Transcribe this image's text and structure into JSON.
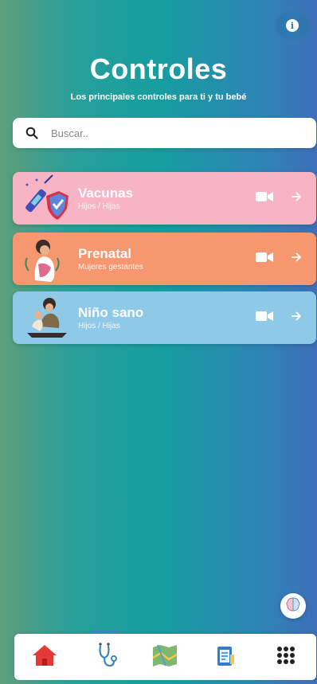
{
  "header": {
    "title": "Controles",
    "subtitle": "Los principales controles para ti y tu bebé"
  },
  "search": {
    "placeholder": "Buscar..",
    "value": ""
  },
  "cards": [
    {
      "name": "Vacunas",
      "subtitle": "Hijos / Hijas",
      "color": "#f7b4c4"
    },
    {
      "name": "Prenatal",
      "subtitle": "Mujeres gestantes",
      "color": "#f6976f"
    },
    {
      "name": "Niño sano",
      "subtitle": "Hijos / Hijas",
      "color": "#8ec9e8"
    }
  ],
  "icons": {
    "info": "info-icon",
    "search": "search-icon",
    "video": "video-camera-icon",
    "arrow": "arrow-right-icon",
    "fab": "brain-icon"
  },
  "bottom_nav": [
    {
      "icon": "home-icon",
      "active": false
    },
    {
      "icon": "stethoscope-icon",
      "active": true
    },
    {
      "icon": "map-icon",
      "active": false
    },
    {
      "icon": "clipboard-icon",
      "active": false
    },
    {
      "icon": "apps-grid-icon",
      "active": false
    }
  ],
  "colors": {
    "home": "#e53935",
    "accent": "#3b86b8"
  }
}
